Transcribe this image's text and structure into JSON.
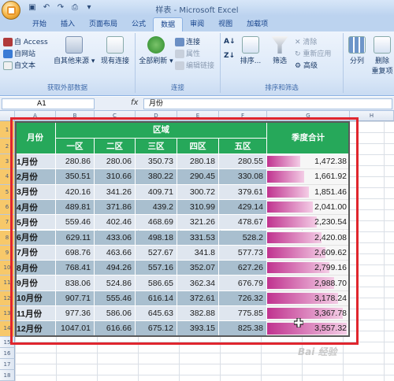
{
  "window": {
    "title": "样表 - Microsoft Excel"
  },
  "tabs": [
    {
      "label": "开始"
    },
    {
      "label": "插入"
    },
    {
      "label": "页面布局"
    },
    {
      "label": "公式"
    },
    {
      "label": "数据",
      "active": true
    },
    {
      "label": "审阅"
    },
    {
      "label": "视图"
    },
    {
      "label": "加载项"
    }
  ],
  "ribbon": {
    "external": {
      "access": "自 Access",
      "web": "自网站",
      "text": "自文本",
      "other": "自其他来源",
      "existing": "现有连接",
      "label": "获取外部数据"
    },
    "connections": {
      "refresh": "全部刷新",
      "conn": "连接",
      "props": "属性",
      "edit": "编辑链接",
      "label": "连接"
    },
    "sort": {
      "sort": "排序...",
      "filter": "筛选",
      "clear": "清除",
      "reapply": "重新应用",
      "advanced": "高级",
      "label": "排序和筛选"
    },
    "tools": {
      "split": "分列",
      "remove": "删除",
      "dup": "重复项"
    }
  },
  "formula_bar": {
    "name_box": "A1",
    "fx": "fx",
    "content": "月份"
  },
  "columns": [
    "A",
    "B",
    "C",
    "D",
    "E",
    "F",
    "G",
    "H"
  ],
  "rows": [
    "1",
    "2",
    "3",
    "4",
    "5",
    "6",
    "7",
    "8",
    "9",
    "10",
    "11",
    "12",
    "13",
    "14",
    "15",
    "16",
    "17",
    "18"
  ],
  "table": {
    "header_month": "月份",
    "header_region": "区域",
    "header_total": "季度合计",
    "sub_headers": [
      "一区",
      "二区",
      "三区",
      "四区",
      "五区"
    ],
    "rows": [
      {
        "month": "1月份",
        "v": [
          "280.86",
          "280.06",
          "350.73",
          "280.18",
          "280.55"
        ],
        "total": "1,472.38",
        "t": 1472.38
      },
      {
        "month": "2月份",
        "v": [
          "350.51",
          "310.66",
          "380.22",
          "290.45",
          "330.08"
        ],
        "total": "1,661.92",
        "t": 1661.92
      },
      {
        "month": "3月份",
        "v": [
          "420.16",
          "341.26",
          "409.71",
          "300.72",
          "379.61"
        ],
        "total": "1,851.46",
        "t": 1851.46
      },
      {
        "month": "4月份",
        "v": [
          "489.81",
          "371.86",
          "439.2",
          "310.99",
          "429.14"
        ],
        "total": "2,041.00",
        "t": 2041.0
      },
      {
        "month": "5月份",
        "v": [
          "559.46",
          "402.46",
          "468.69",
          "321.26",
          "478.67"
        ],
        "total": "2,230.54",
        "t": 2230.54
      },
      {
        "month": "6月份",
        "v": [
          "629.11",
          "433.06",
          "498.18",
          "331.53",
          "528.2"
        ],
        "total": "2,420.08",
        "t": 2420.08
      },
      {
        "month": "7月份",
        "v": [
          "698.76",
          "463.66",
          "527.67",
          "341.8",
          "577.73"
        ],
        "total": "2,609.62",
        "t": 2609.62
      },
      {
        "month": "8月份",
        "v": [
          "768.41",
          "494.26",
          "557.16",
          "352.07",
          "627.26"
        ],
        "total": "2,799.16",
        "t": 2799.16
      },
      {
        "month": "9月份",
        "v": [
          "838.06",
          "524.86",
          "586.65",
          "362.34",
          "676.79"
        ],
        "total": "2,988.70",
        "t": 2988.7
      },
      {
        "month": "10月份",
        "v": [
          "907.71",
          "555.46",
          "616.14",
          "372.61",
          "726.32"
        ],
        "total": "3,178.24",
        "t": 3178.24
      },
      {
        "month": "11月份",
        "v": [
          "977.36",
          "586.06",
          "645.63",
          "382.88",
          "775.85"
        ],
        "total": "3,367.78",
        "t": 3367.78
      },
      {
        "month": "12月份",
        "v": [
          "1047.01",
          "616.66",
          "675.12",
          "393.15",
          "825.38"
        ],
        "total": "3,557.32",
        "t": 3557.32
      }
    ]
  },
  "watermark": "Bai 经验",
  "colors": {
    "header_green": "#26a85a",
    "band_light": "#dfe6ef",
    "band_dark": "#a9bfcf",
    "databar": "#c0338f",
    "highlight_frame": "#e0262e"
  }
}
